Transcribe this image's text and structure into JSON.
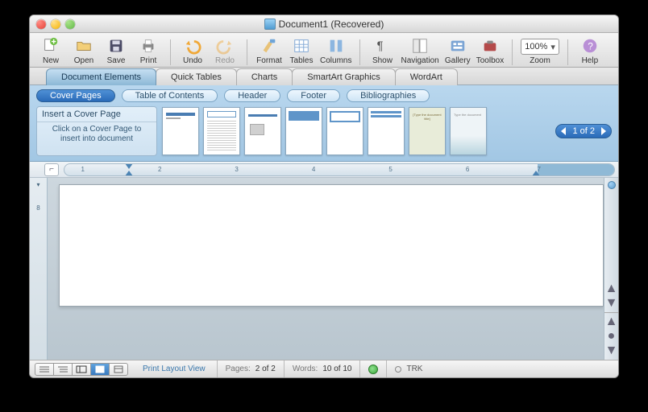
{
  "window": {
    "title": "Document1 (Recovered)"
  },
  "toolbar": {
    "new": "New",
    "open": "Open",
    "save": "Save",
    "print": "Print",
    "undo": "Undo",
    "redo": "Redo",
    "format": "Format",
    "tables": "Tables",
    "columns": "Columns",
    "show": "Show",
    "navigation": "Navigation",
    "gallery": "Gallery",
    "toolbox": "Toolbox",
    "help": "Help",
    "zoom_label": "Zoom",
    "zoom_value": "100%"
  },
  "element_tabs": {
    "items": [
      "Document Elements",
      "Quick Tables",
      "Charts",
      "SmartArt Graphics",
      "WordArt"
    ],
    "active": "Document Elements"
  },
  "subtabs": {
    "items": [
      "Cover Pages",
      "Table of Contents",
      "Header",
      "Footer",
      "Bibliographies"
    ],
    "active": "Cover Pages"
  },
  "insert_box": {
    "title": "Insert a Cover Page",
    "desc": "Click on a Cover Page to insert into document"
  },
  "pager": {
    "text": "1 of 2"
  },
  "ruler": {
    "marks": [
      "1",
      "2",
      "3",
      "4",
      "5",
      "6",
      "7"
    ]
  },
  "vruler": {
    "mark": "8"
  },
  "status": {
    "view": "Print Layout View",
    "pages_label": "Pages:",
    "pages_value": "2 of 2",
    "words_label": "Words:",
    "words_value": "10 of 10",
    "trk": "TRK"
  }
}
